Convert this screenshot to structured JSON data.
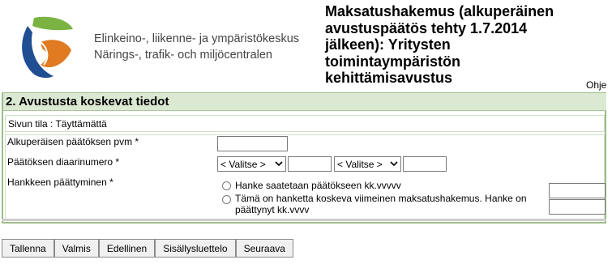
{
  "header": {
    "org_name_fi": "Elinkeino-, liikenne- ja ympäristökeskus",
    "org_name_sv": "Närings-, trafik- och miljöcentralen",
    "form_title": "Maksatushakemus (alkuperäinen avustuspäätös tehty 1.7.2014 jälkeen): Yritysten toimintaympäristön kehittämisavustus",
    "help_label": "Ohje"
  },
  "section": {
    "title": "2. Avustusta koskevat tiedot",
    "status": "Sivun tila : Täyttämättä"
  },
  "fields": {
    "original_decision_date": {
      "label": "Alkuperäisen päätöksen pvm *",
      "value": ""
    },
    "decision_diary_number": {
      "label": "Päätöksen diaarinumero *",
      "select1": "< Valitse >",
      "input1": "",
      "select2": "< Valitse >",
      "input2": ""
    },
    "project_end": {
      "label": "Hankkeen päättyminen *",
      "option1": "Hanke saatetaan päätökseen kk.vvvvv",
      "option2": "Tämä on hanketta koskeva viimeinen maksatushakemus. Hanke on päättynyt kk.vvvv",
      "input1": "",
      "input2": ""
    }
  },
  "buttons": {
    "save": "Tallenna",
    "ready": "Valmis",
    "previous": "Edellinen",
    "toc": "Sisällysluettelo",
    "next": "Seuraava"
  },
  "colors": {
    "section_border": "#9dbd8b",
    "section_header_bg": "#dbe9d3",
    "logo_blue": "#1f4e93",
    "logo_green": "#7bb342",
    "logo_orange": "#e07b21"
  }
}
